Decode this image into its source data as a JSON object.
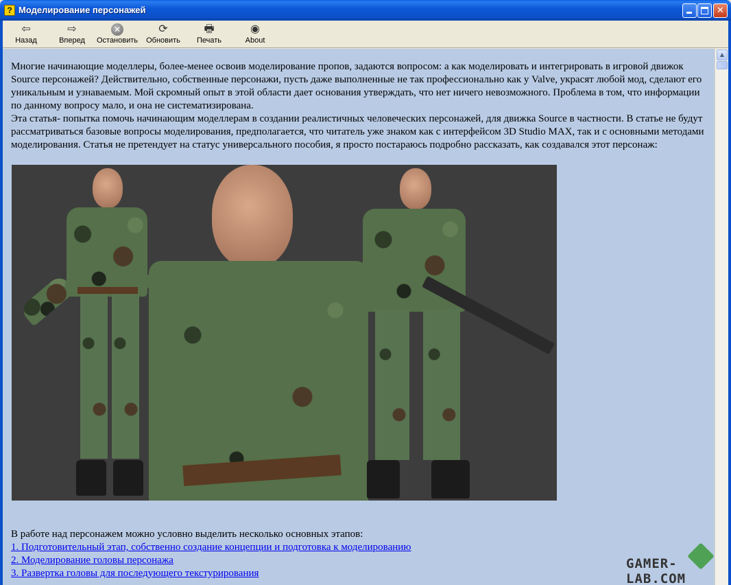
{
  "window": {
    "title": "Моделирование персонажей",
    "icon": "help-question-icon"
  },
  "toolbar": {
    "back_label": "Назад",
    "forward_label": "Вперед",
    "stop_label": "Остановить",
    "refresh_label": "Обновить",
    "print_label": "Печать",
    "about_label": "About"
  },
  "article": {
    "paragraph1": "Многие начинающие моделлеры, более-менее освоив моделирование пропов, задаются вопросом: а как моделировать и интегрировать в игровой движок Source персонажей? Действительно, собственные персонажи, пусть даже выполненные не так профессионально как у Valve, украсят любой мод, сделают его уникальным и узнаваемым. Мой скромный опыт в этой области дает основания утверждать, что нет ничего невозможного. Проблема в том, что информации по данному вопросу мало, и она не систематизирована.",
    "paragraph2": "Эта статья- попытка помочь начинающим моделлерам в создании реалистичных человеческих персонажей, для движка Source в частности. В статье не будут рассматриваться базовые вопросы моделирования, предполагается, что читатель уже знаком как с интерфейсом 3D Studio MAX, так и с основными методами моделирования. Статья не претендует на статус универсального пособия, я просто постараюсь подробно рассказать, как создавался этот персонаж:",
    "stages_intro": "В работе над персонажем можно условно выделить несколько основных этапов:",
    "links": [
      "1. Подготовительный этап, собственно создание концепции и подготовка к моделированию",
      "2. Моделирование головы персонажа",
      "3. Развертка головы для последующего текстурирования"
    ]
  },
  "watermark": "GAMER-LAB.COM",
  "colors": {
    "titlebar": "#0B50C8",
    "content_bg": "#B9CBE4",
    "link": "#0000EE",
    "image_bg": "#3d3d3d"
  }
}
